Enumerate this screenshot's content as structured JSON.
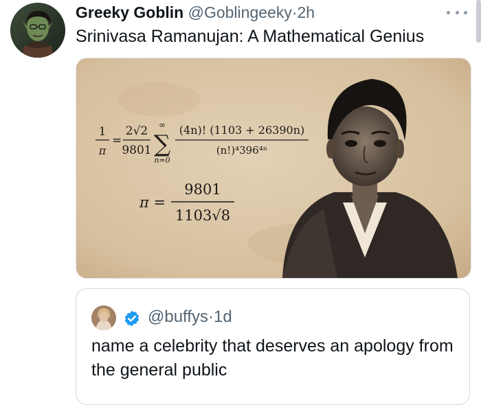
{
  "post": {
    "author_name": "Greeky Goblin",
    "author_handle": "@Goblingeeky",
    "separator": "·",
    "time": "2h",
    "text": "Srinivasa Ramanujan: A Mathematical Genius"
  },
  "media": {
    "formula_one": {
      "lhs_num": "1",
      "lhs_den": "π",
      "equals": "=",
      "coef_num": "2√2",
      "coef_den": "9801",
      "sum_sign": "∑",
      "sum_upper": "∞",
      "sum_lower": "n=0",
      "term_num": "(4n)! (1103 + 26390n)",
      "term_den": "(n!)⁴396⁴ⁿ"
    },
    "formula_two": {
      "lhs": "π =",
      "num": "9801",
      "den": "1103√8"
    }
  },
  "quote": {
    "handle": "@buffys",
    "separator": "·",
    "time": "1d",
    "text": "name a celebrity that deserves an apology from the general public"
  },
  "colors": {
    "verified": "#1d9bf0",
    "secondary_text": "#536471",
    "parchment": "#d8c3a5"
  },
  "icons": {
    "more": "more-horizontal-icon",
    "verified": "verified-badge-icon"
  }
}
